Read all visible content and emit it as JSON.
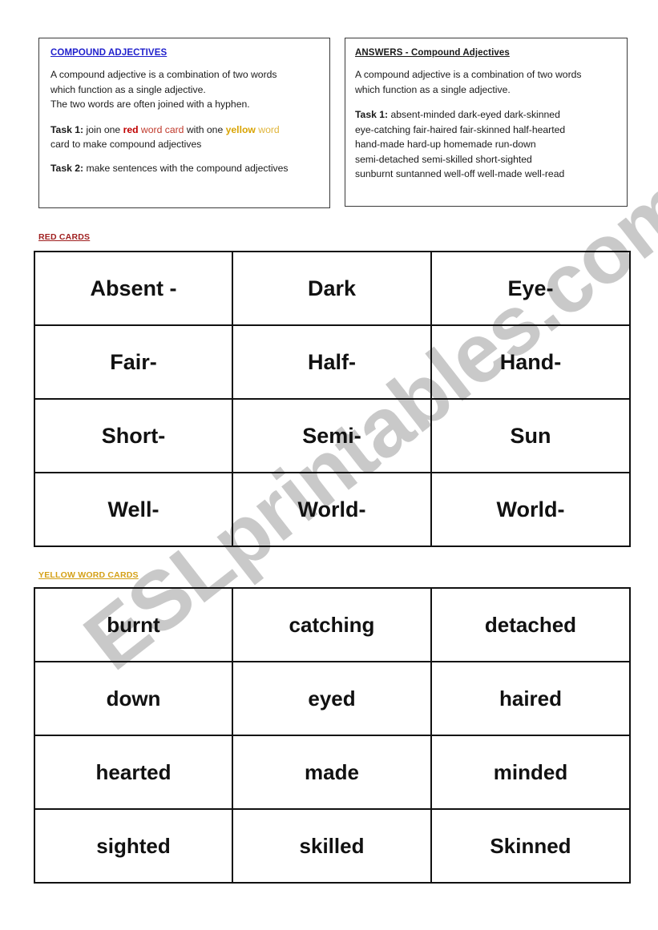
{
  "worksheet": {
    "watermark": "ESLprintables.com",
    "info_panel": {
      "title": "COMPOUND ADJECTIVES",
      "definition_line1": "A compound adjective is a combination of two words",
      "definition_line2": "which function as a single adjective.",
      "definition_line3": "The two words are often joined with a hyphen.",
      "task1_label": "Task 1:",
      "task1_text_a": " join one ",
      "task1_red_bold": "red",
      "task1_red_rest": " word card",
      "task1_text_b": " with one ",
      "task1_yellow_bold": "yellow",
      "task1_yellow_rest": " word",
      "task1_text_c": "card to make compound adjectives",
      "task2_label": "Task 2:",
      "task2_text": " make sentences with the compound adjectives"
    },
    "answers_panel": {
      "title": "ANSWERS - Compound Adjectives",
      "definition_line1": "A compound adjective is a combination of two words",
      "definition_line2": "which function as a single adjective.",
      "task1_label": "Task 1:",
      "answers_line1": "absent-minded   dark-eyed   dark-skinned",
      "answers_line2": "eye-catching   fair-haired   fair-skinned   half-hearted",
      "answers_line3": "hand-made    hard-up    homemade  run-down",
      "answers_line4": "semi-detached   semi-skilled  short-sighted",
      "answers_line5": "sunburnt   suntanned   well-off  well-made  well-read"
    },
    "red_section": {
      "label": "RED CARDS",
      "rows": [
        [
          "Absent -",
          "Dark",
          "Eye-"
        ],
        [
          "Fair-",
          "Half-",
          "Hand-"
        ],
        [
          "Short-",
          "Semi-",
          "Sun"
        ],
        [
          "Well-",
          "World-",
          "World-"
        ]
      ]
    },
    "yellow_section": {
      "label": "YELLOW WORD CARDS",
      "rows": [
        [
          "burnt",
          "catching",
          "detached"
        ],
        [
          "down",
          "eyed",
          "haired"
        ],
        [
          "hearted",
          "made",
          "minded"
        ],
        [
          "sighted",
          "skilled",
          "Skinned"
        ]
      ]
    },
    "colors": {
      "title_blue": "#1f1fcc",
      "answers_blue": "#3333a8",
      "red_label": "#a02020",
      "yellow_label": "#d4a017",
      "red_word": "#c00000",
      "yellow_word": "#d9a404",
      "card_border": "#111111",
      "watermark_gray": "#c9c9c9"
    }
  }
}
